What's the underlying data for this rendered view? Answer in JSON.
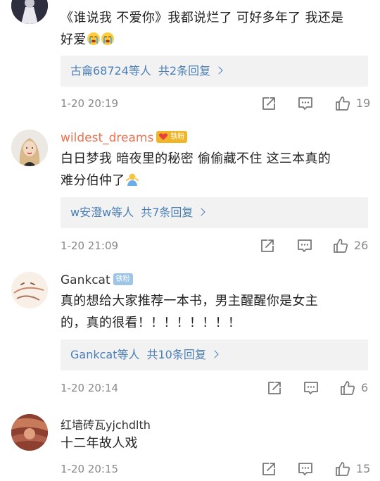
{
  "comments": [
    {
      "username": "",
      "text_line1": "《谁说我 不爱你》我都说烂了 可好多年了 我还是",
      "text_line2": "好爱",
      "reply_user": "古龠68724等人",
      "reply_count": "共2条回复",
      "time": "1-20 20:19",
      "likes": "19"
    },
    {
      "username": "wildest_dreams",
      "badge": "铁粉",
      "text_line1": "白日梦我 暗夜里的秘密 偷偷藏不住 这三本真的",
      "text_line2": "难分伯仲了",
      "reply_user": "w安澄w等人",
      "reply_count": "共7条回复",
      "time": "1-20 21:09",
      "likes": "26"
    },
    {
      "username": "Gankcat",
      "badge": "铁粉",
      "text_line1": "真的想给大家推荐一本书，男主醒醒你是女主",
      "text_line2": "的，真的很看！！！！！！！！",
      "reply_user": "Gankcat等人",
      "reply_count": "共10条回复",
      "time": "1-20 20:14",
      "likes": "6"
    },
    {
      "username": "红墙砖瓦yjchdlth",
      "text_line1": "十二年故人戏",
      "time": "1-20 20:15",
      "likes": "15"
    }
  ],
  "icons": {
    "repost": "share-icon",
    "comment": "comment-icon",
    "like": "thumbs-up-icon",
    "crying": "crying-emoji-icon",
    "shrug": "shrug-emoji-icon"
  },
  "colors": {
    "link": "#4a7fb5",
    "vip_name": "#eb7350",
    "badge_gold": "#f0b62a",
    "badge_blue": "#9ec4e6",
    "reply_bg": "#f2f2f2"
  }
}
